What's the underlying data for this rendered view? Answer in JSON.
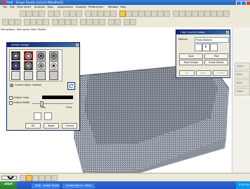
{
  "titlebar": {
    "title": "ProE - Shape Studio  [ssf.prt (Modified)]"
  },
  "menu": {
    "items": [
      "File",
      "Edit",
      "View",
      "Insert",
      "Analysis",
      "Tools",
      "Applications",
      "Analysis",
      "Preferences",
      "Window",
      "Help"
    ]
  },
  "toolbar": {
    "start_label": "Start"
  },
  "status": {
    "message": "Set options, then press Start Shade"
  },
  "right_panel": {
    "buttons": [
      "Apply",
      "Back",
      "Back",
      "Reset"
    ]
  },
  "artistic_dialog": {
    "title": "Artistic Image",
    "style_label": "Current Style: Cartoon",
    "outline_color_label": "Outline Color",
    "outline_width_label": "Outline Width",
    "thin_label": "Thin",
    "thick_label": "Thick",
    "ok": "OK",
    "apply": "Apply",
    "cancel": "Cancel"
  },
  "hq_dialog": {
    "title": "High Quality Image",
    "method_label": "Method",
    "method_value": "Photo-Realistic",
    "save": "Save",
    "plot": "Plot",
    "start_shade": "Start Shade",
    "erase_shade": "Erase Shade",
    "ok": "OK",
    "back": "Back",
    "cancel": "Cancel"
  },
  "bottombar": {
    "mode": "Standard"
  },
  "taskbar": {
    "start": "start",
    "tasks": [
      "ProE - Shape Studio",
      "model-source - Paint"
    ],
    "clock": "5:43 PM"
  },
  "colors": {
    "title_blue": "#1d5bc1",
    "taskbar_blue": "#2152c0",
    "start_green": "#2b7d2b",
    "dialog_bg": "#ece9d8"
  }
}
